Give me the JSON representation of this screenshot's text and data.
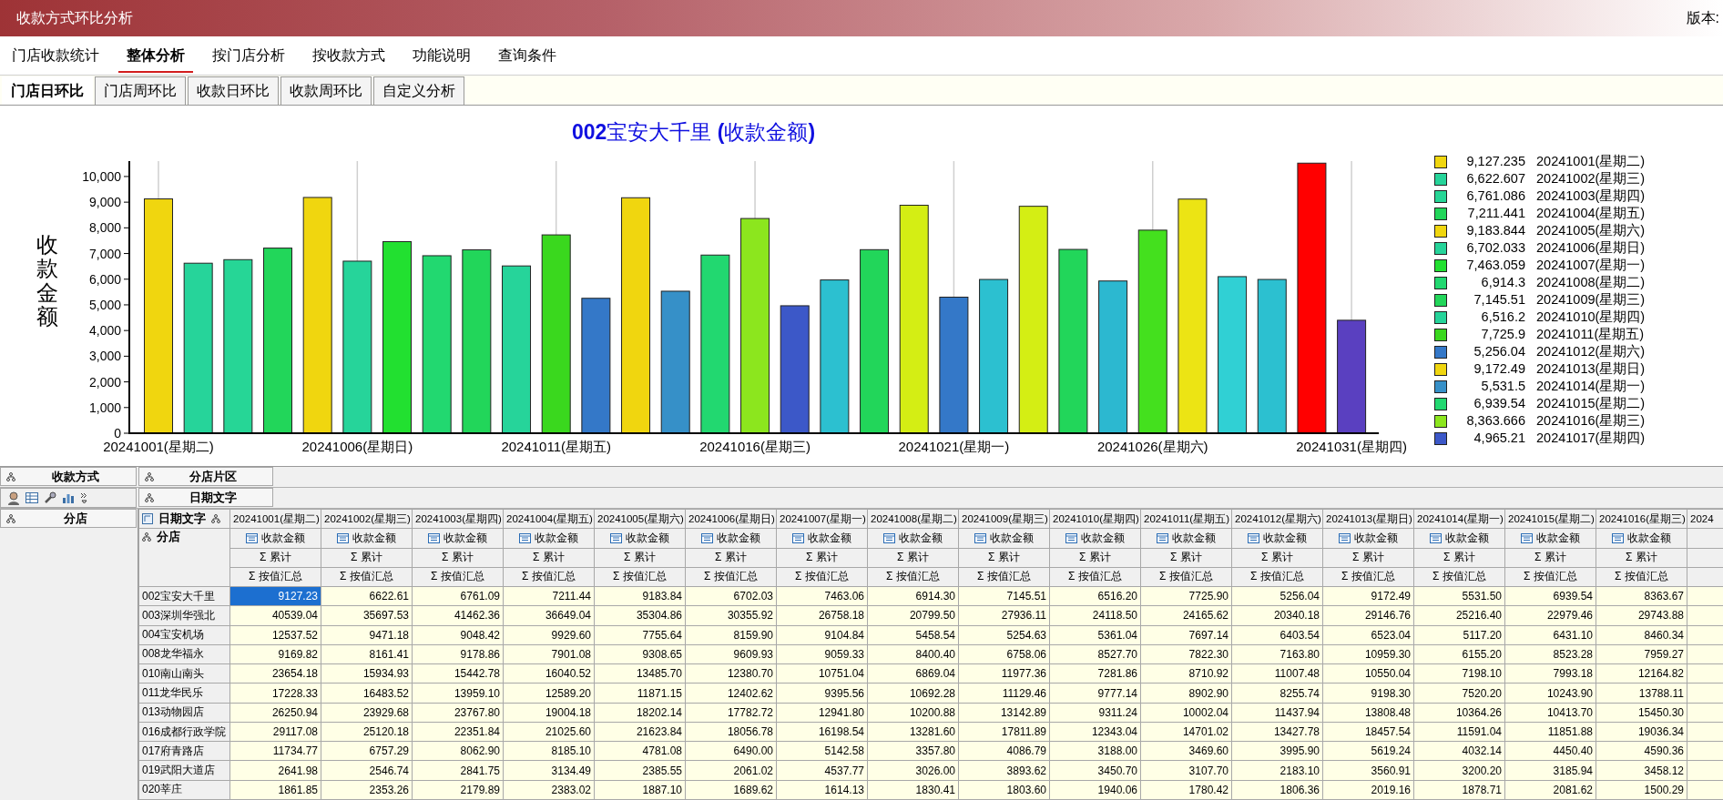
{
  "window": {
    "title": "收款方式环比分析",
    "version_label": "版本:"
  },
  "menu": [
    {
      "label": "门店收款统计",
      "selected": false
    },
    {
      "label": "整体分析",
      "selected": true
    },
    {
      "label": "按门店分析",
      "selected": false
    },
    {
      "label": "按收款方式",
      "selected": false
    },
    {
      "label": "功能说明",
      "selected": false
    },
    {
      "label": "查询条件",
      "selected": false
    }
  ],
  "subtabs": [
    {
      "label": "门店日环比",
      "selected": true
    },
    {
      "label": "门店周环比",
      "selected": false
    },
    {
      "label": "收款日环比",
      "selected": false
    },
    {
      "label": "收款周环比",
      "selected": false
    },
    {
      "label": "自定义分析",
      "selected": false
    }
  ],
  "chart": {
    "chart_data": {
      "type": "bar",
      "title": "**002**宝安大千里 **(**收款金额**)**",
      "ylabel": "收款金额",
      "categories": [
        "20241001(星期二)",
        null,
        null,
        null,
        null,
        "20241006(星期日)",
        null,
        null,
        null,
        null,
        "20241011(星期五)",
        null,
        null,
        null,
        null,
        "20241016(星期三)",
        null,
        null,
        null,
        null,
        "20241021(星期一)",
        null,
        null,
        null,
        null,
        "20241026(星期六)",
        null,
        null,
        null,
        null,
        "20241031(星期四)"
      ],
      "grid": true,
      "series": [
        {
          "values": [
            9127.235,
            6622.607,
            6761.086,
            7211.441,
            9183.844,
            6702.033,
            7463.059,
            6914.3,
            7145.51,
            6516.2,
            7725.9,
            5256.04,
            9172.49,
            5531.5,
            6939.54,
            8363.666,
            4965.21,
            5970,
            7150,
            8880,
            5300,
            5990,
            8840,
            7160,
            5930,
            7910,
            9120,
            6100,
            5990,
            10520,
            4400
          ],
          "colors": [
            "#f0d60f",
            "#26d49a",
            "#26d696",
            "#22d65a",
            "#f0d60f",
            "#26d49a",
            "#22e030",
            "#22d870",
            "#22d65a",
            "#26d49a",
            "#3ad81e",
            "#3478c8",
            "#f0d60f",
            "#3690c8",
            "#22d870",
            "#8ce61e",
            "#3c58c8",
            "#2cc0d0",
            "#22d65a",
            "#d4ee14",
            "#3478c8",
            "#2cc0d0",
            "#d4ee14",
            "#22d65a",
            "#2cb8d0",
            "#44e01e",
            "#ece414",
            "#30d0d4",
            "#2cc0d0",
            "#ff0000",
            "#5a40c0"
          ]
        }
      ],
      "ylim": [
        0,
        10600
      ],
      "yticks": [
        {
          "value": 0,
          "label": "0"
        },
        {
          "value": 1000,
          "label": "1,000"
        },
        {
          "value": 2000,
          "label": "2,000"
        },
        {
          "value": 3000,
          "label": "3,000"
        },
        {
          "value": 4000,
          "label": "4,000"
        },
        {
          "value": 5000,
          "label": "5,000"
        },
        {
          "value": 6000,
          "label": "6,000"
        },
        {
          "value": 7000,
          "label": "7,000"
        },
        {
          "value": 8000,
          "label": "8,000"
        },
        {
          "value": 9000,
          "label": "9,000"
        },
        {
          "value": 10000,
          "label": "10,000"
        }
      ]
    },
    "legend": [
      {
        "color": "#f0d60f",
        "amount": "9,127.235",
        "date": "20241001(星期二)"
      },
      {
        "color": "#26d49a",
        "amount": "6,622.607",
        "date": "20241002(星期三)"
      },
      {
        "color": "#26d696",
        "amount": "6,761.086",
        "date": "20241003(星期四)"
      },
      {
        "color": "#22d65a",
        "amount": "7,211.441",
        "date": "20241004(星期五)"
      },
      {
        "color": "#f0d60f",
        "amount": "9,183.844",
        "date": "20241005(星期六)"
      },
      {
        "color": "#26d49a",
        "amount": "6,702.033",
        "date": "20241006(星期日)"
      },
      {
        "color": "#22e030",
        "amount": "7,463.059",
        "date": "20241007(星期一)"
      },
      {
        "color": "#22d870",
        "amount": "6,914.3",
        "date": "20241008(星期二)"
      },
      {
        "color": "#22d65a",
        "amount": "7,145.51",
        "date": "20241009(星期三)"
      },
      {
        "color": "#26d49a",
        "amount": "6,516.2",
        "date": "20241010(星期四)"
      },
      {
        "color": "#3ad81e",
        "amount": "7,725.9",
        "date": "20241011(星期五)"
      },
      {
        "color": "#3478c8",
        "amount": "5,256.04",
        "date": "20241012(星期六)"
      },
      {
        "color": "#f0d60f",
        "amount": "9,172.49",
        "date": "20241013(星期日)"
      },
      {
        "color": "#3690c8",
        "amount": "5,531.5",
        "date": "20241014(星期一)"
      },
      {
        "color": "#22d870",
        "amount": "6,939.54",
        "date": "20241015(星期二)"
      },
      {
        "color": "#8ce61e",
        "amount": "8,363.666",
        "date": "20241016(星期三)"
      },
      {
        "color": "#3c58c8",
        "amount": "4,965.21",
        "date": "20241017(星期四)"
      }
    ]
  },
  "pivot": {
    "data_field": "收款方式",
    "filter_field": "分店片区",
    "column_field": "日期文字",
    "row_field": "分店",
    "corner_column_field": "日期文字",
    "corner_row_field": "分店"
  },
  "table": {
    "columns": [
      {
        "date": "20241001(星期二)",
        "measure": "收款金额",
        "total": "Σ 累计",
        "summary": "Σ 按值汇总"
      },
      {
        "date": "20241002(星期三)",
        "measure": "收款金额",
        "total": "Σ 累计",
        "summary": "Σ 按值汇总"
      },
      {
        "date": "20241003(星期四)",
        "measure": "收款金额",
        "total": "Σ 累计",
        "summary": "Σ 按值汇总"
      },
      {
        "date": "20241004(星期五)",
        "measure": "收款金额",
        "total": "Σ 累计",
        "summary": "Σ 按值汇总"
      },
      {
        "date": "20241005(星期六)",
        "measure": "收款金额",
        "total": "Σ 累计",
        "summary": "Σ 按值汇总"
      },
      {
        "date": "20241006(星期日)",
        "measure": "收款金额",
        "total": "Σ 累计",
        "summary": "Σ 按值汇总"
      },
      {
        "date": "20241007(星期一)",
        "measure": "收款金额",
        "total": "Σ 累计",
        "summary": "Σ 按值汇总"
      },
      {
        "date": "20241008(星期二)",
        "measure": "收款金额",
        "total": "Σ 累计",
        "summary": "Σ 按值汇总"
      },
      {
        "date": "20241009(星期三)",
        "measure": "收款金额",
        "total": "Σ 累计",
        "summary": "Σ 按值汇总"
      },
      {
        "date": "20241010(星期四)",
        "measure": "收款金额",
        "total": "Σ 累计",
        "summary": "Σ 按值汇总"
      },
      {
        "date": "20241011(星期五)",
        "measure": "收款金额",
        "total": "Σ 累计",
        "summary": "Σ 按值汇总"
      },
      {
        "date": "20241012(星期六)",
        "measure": "收款金额",
        "total": "Σ 累计",
        "summary": "Σ 按值汇总"
      },
      {
        "date": "20241013(星期日)",
        "measure": "收款金额",
        "total": "Σ 累计",
        "summary": "Σ 按值汇总"
      },
      {
        "date": "20241014(星期一)",
        "measure": "收款金额",
        "total": "Σ 累计",
        "summary": "Σ 按值汇总"
      },
      {
        "date": "20241015(星期二)",
        "measure": "收款金额",
        "total": "Σ 累计",
        "summary": "Σ 按值汇总"
      },
      {
        "date": "20241016(星期三)",
        "measure": "收款金额",
        "total": "Σ 累计",
        "summary": "Σ 按值汇总"
      }
    ],
    "partial_column": "2024",
    "rows": [
      {
        "name": "002宝安大千里",
        "cells": [
          {
            "value": "9127.23",
            "selected": true
          },
          {
            "value": "6622.61",
            "selected": false
          },
          {
            "value": "6761.09",
            "selected": false
          },
          {
            "value": "7211.44",
            "selected": false
          },
          {
            "value": "9183.84",
            "selected": false
          },
          {
            "value": "6702.03",
            "selected": false
          },
          {
            "value": "7463.06",
            "selected": false
          },
          {
            "value": "6914.30",
            "selected": false
          },
          {
            "value": "7145.51",
            "selected": false
          },
          {
            "value": "6516.20",
            "selected": false
          },
          {
            "value": "7725.90",
            "selected": false
          },
          {
            "value": "5256.04",
            "selected": false
          },
          {
            "value": "9172.49",
            "selected": false
          },
          {
            "value": "5531.50",
            "selected": false
          },
          {
            "value": "6939.54",
            "selected": false
          },
          {
            "value": "8363.67",
            "selected": false
          }
        ]
      },
      {
        "name": "003深圳华强北",
        "cells": [
          {
            "value": "40539.04",
            "selected": false
          },
          {
            "value": "35697.53",
            "selected": false
          },
          {
            "value": "41462.36",
            "selected": false
          },
          {
            "value": "36649.04",
            "selected": false
          },
          {
            "value": "35304.86",
            "selected": false
          },
          {
            "value": "30355.92",
            "selected": false
          },
          {
            "value": "26758.18",
            "selected": false
          },
          {
            "value": "20799.50",
            "selected": false
          },
          {
            "value": "27936.11",
            "selected": false
          },
          {
            "value": "24118.50",
            "selected": false
          },
          {
            "value": "24165.62",
            "selected": false
          },
          {
            "value": "20340.18",
            "selected": false
          },
          {
            "value": "29146.76",
            "selected": false
          },
          {
            "value": "25216.40",
            "selected": false
          },
          {
            "value": "22979.46",
            "selected": false
          },
          {
            "value": "29743.88",
            "selected": false
          }
        ]
      },
      {
        "name": "004宝安机场",
        "cells": [
          {
            "value": "12537.52",
            "selected": false
          },
          {
            "value": "9471.18",
            "selected": false
          },
          {
            "value": "9048.42",
            "selected": false
          },
          {
            "value": "9929.60",
            "selected": false
          },
          {
            "value": "7755.64",
            "selected": false
          },
          {
            "value": "8159.90",
            "selected": false
          },
          {
            "value": "9104.84",
            "selected": false
          },
          {
            "value": "5458.54",
            "selected": false
          },
          {
            "value": "5254.63",
            "selected": false
          },
          {
            "value": "5361.04",
            "selected": false
          },
          {
            "value": "7697.14",
            "selected": false
          },
          {
            "value": "6403.54",
            "selected": false
          },
          {
            "value": "6523.04",
            "selected": false
          },
          {
            "value": "5117.20",
            "selected": false
          },
          {
            "value": "6431.10",
            "selected": false
          },
          {
            "value": "8460.34",
            "selected": false
          }
        ]
      },
      {
        "name": "008龙华福永",
        "cells": [
          {
            "value": "9169.82",
            "selected": false
          },
          {
            "value": "8161.41",
            "selected": false
          },
          {
            "value": "9178.86",
            "selected": false
          },
          {
            "value": "7901.08",
            "selected": false
          },
          {
            "value": "9308.65",
            "selected": false
          },
          {
            "value": "9609.93",
            "selected": false
          },
          {
            "value": "9059.33",
            "selected": false
          },
          {
            "value": "8400.40",
            "selected": false
          },
          {
            "value": "6758.06",
            "selected": false
          },
          {
            "value": "8527.70",
            "selected": false
          },
          {
            "value": "7822.30",
            "selected": false
          },
          {
            "value": "7163.80",
            "selected": false
          },
          {
            "value": "10959.30",
            "selected": false
          },
          {
            "value": "6155.20",
            "selected": false
          },
          {
            "value": "8523.28",
            "selected": false
          },
          {
            "value": "7959.27",
            "selected": false
          }
        ]
      },
      {
        "name": "010南山南头",
        "cells": [
          {
            "value": "23654.18",
            "selected": false
          },
          {
            "value": "15934.93",
            "selected": false
          },
          {
            "value": "15442.78",
            "selected": false
          },
          {
            "value": "16040.52",
            "selected": false
          },
          {
            "value": "13485.70",
            "selected": false
          },
          {
            "value": "12380.70",
            "selected": false
          },
          {
            "value": "10751.04",
            "selected": false
          },
          {
            "value": "6869.04",
            "selected": false
          },
          {
            "value": "11977.36",
            "selected": false
          },
          {
            "value": "7281.86",
            "selected": false
          },
          {
            "value": "8710.92",
            "selected": false
          },
          {
            "value": "11007.48",
            "selected": false
          },
          {
            "value": "10550.04",
            "selected": false
          },
          {
            "value": "7198.10",
            "selected": false
          },
          {
            "value": "7993.18",
            "selected": false
          },
          {
            "value": "12164.82",
            "selected": false
          }
        ]
      },
      {
        "name": "011龙华民乐",
        "cells": [
          {
            "value": "17228.33",
            "selected": false
          },
          {
            "value": "16483.52",
            "selected": false
          },
          {
            "value": "13959.10",
            "selected": false
          },
          {
            "value": "12589.20",
            "selected": false
          },
          {
            "value": "11871.15",
            "selected": false
          },
          {
            "value": "12402.62",
            "selected": false
          },
          {
            "value": "9395.56",
            "selected": false
          },
          {
            "value": "10692.28",
            "selected": false
          },
          {
            "value": "11129.46",
            "selected": false
          },
          {
            "value": "9777.14",
            "selected": false
          },
          {
            "value": "8902.90",
            "selected": false
          },
          {
            "value": "8255.74",
            "selected": false
          },
          {
            "value": "9198.30",
            "selected": false
          },
          {
            "value": "7520.20",
            "selected": false
          },
          {
            "value": "10243.90",
            "selected": false
          },
          {
            "value": "13788.11",
            "selected": false
          }
        ]
      },
      {
        "name": "013动物园店",
        "cells": [
          {
            "value": "26250.94",
            "selected": false
          },
          {
            "value": "23929.68",
            "selected": false
          },
          {
            "value": "23767.80",
            "selected": false
          },
          {
            "value": "19004.18",
            "selected": false
          },
          {
            "value": "18202.14",
            "selected": false
          },
          {
            "value": "17782.72",
            "selected": false
          },
          {
            "value": "12941.80",
            "selected": false
          },
          {
            "value": "10200.88",
            "selected": false
          },
          {
            "value": "13142.89",
            "selected": false
          },
          {
            "value": "9311.24",
            "selected": false
          },
          {
            "value": "10002.04",
            "selected": false
          },
          {
            "value": "11437.94",
            "selected": false
          },
          {
            "value": "13808.48",
            "selected": false
          },
          {
            "value": "10364.26",
            "selected": false
          },
          {
            "value": "10413.70",
            "selected": false
          },
          {
            "value": "15450.30",
            "selected": false
          }
        ]
      },
      {
        "name": "016成都行政学院",
        "cells": [
          {
            "value": "29117.08",
            "selected": false
          },
          {
            "value": "25120.18",
            "selected": false
          },
          {
            "value": "22351.84",
            "selected": false
          },
          {
            "value": "21025.60",
            "selected": false
          },
          {
            "value": "21623.84",
            "selected": false
          },
          {
            "value": "18056.78",
            "selected": false
          },
          {
            "value": "16198.54",
            "selected": false
          },
          {
            "value": "13281.60",
            "selected": false
          },
          {
            "value": "17811.89",
            "selected": false
          },
          {
            "value": "12343.04",
            "selected": false
          },
          {
            "value": "14701.02",
            "selected": false
          },
          {
            "value": "13427.78",
            "selected": false
          },
          {
            "value": "18457.54",
            "selected": false
          },
          {
            "value": "11591.04",
            "selected": false
          },
          {
            "value": "11851.88",
            "selected": false
          },
          {
            "value": "19036.34",
            "selected": false
          }
        ]
      },
      {
        "name": "017府青路店",
        "cells": [
          {
            "value": "11734.77",
            "selected": false
          },
          {
            "value": "6757.29",
            "selected": false
          },
          {
            "value": "8062.90",
            "selected": false
          },
          {
            "value": "8185.10",
            "selected": false
          },
          {
            "value": "4781.08",
            "selected": false
          },
          {
            "value": "6490.00",
            "selected": false
          },
          {
            "value": "5142.58",
            "selected": false
          },
          {
            "value": "3357.80",
            "selected": false
          },
          {
            "value": "4086.79",
            "selected": false
          },
          {
            "value": "3188.00",
            "selected": false
          },
          {
            "value": "3469.60",
            "selected": false
          },
          {
            "value": "3995.90",
            "selected": false
          },
          {
            "value": "5619.24",
            "selected": false
          },
          {
            "value": "4032.14",
            "selected": false
          },
          {
            "value": "4450.40",
            "selected": false
          },
          {
            "value": "4590.36",
            "selected": false
          }
        ]
      },
      {
        "name": "019武阳大道店",
        "cells": [
          {
            "value": "2641.98",
            "selected": false
          },
          {
            "value": "2546.74",
            "selected": false
          },
          {
            "value": "2841.75",
            "selected": false
          },
          {
            "value": "3134.49",
            "selected": false
          },
          {
            "value": "2385.55",
            "selected": false
          },
          {
            "value": "2061.02",
            "selected": false
          },
          {
            "value": "4537.77",
            "selected": false
          },
          {
            "value": "3026.00",
            "selected": false
          },
          {
            "value": "3893.62",
            "selected": false
          },
          {
            "value": "3450.70",
            "selected": false
          },
          {
            "value": "3107.70",
            "selected": false
          },
          {
            "value": "2183.10",
            "selected": false
          },
          {
            "value": "3560.91",
            "selected": false
          },
          {
            "value": "3200.20",
            "selected": false
          },
          {
            "value": "3185.94",
            "selected": false
          },
          {
            "value": "3458.12",
            "selected": false
          }
        ]
      },
      {
        "name": "020莘庄",
        "cells": [
          {
            "value": "1861.85",
            "selected": false
          },
          {
            "value": "2353.26",
            "selected": false
          },
          {
            "value": "2179.89",
            "selected": false
          },
          {
            "value": "2383.02",
            "selected": false
          },
          {
            "value": "1887.10",
            "selected": false
          },
          {
            "value": "1689.62",
            "selected": false
          },
          {
            "value": "1614.13",
            "selected": false
          },
          {
            "value": "1830.41",
            "selected": false
          },
          {
            "value": "1803.60",
            "selected": false
          },
          {
            "value": "1940.06",
            "selected": false
          },
          {
            "value": "1780.42",
            "selected": false
          },
          {
            "value": "1806.36",
            "selected": false
          },
          {
            "value": "2019.16",
            "selected": false
          },
          {
            "value": "1878.71",
            "selected": false
          },
          {
            "value": "2081.62",
            "selected": false
          },
          {
            "value": "1500.29",
            "selected": false
          }
        ]
      }
    ]
  }
}
